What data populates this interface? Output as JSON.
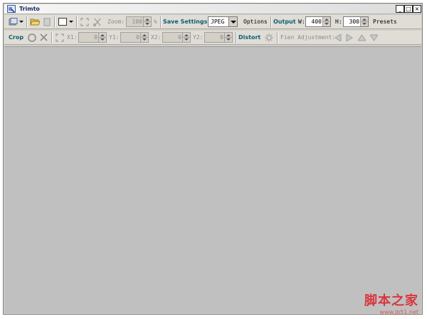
{
  "window": {
    "title": "Trimto",
    "controls": {
      "minimize": "_",
      "maximize": "□",
      "close": "×"
    }
  },
  "toolbar1": {
    "zoom_label": "Zoom:",
    "zoom_value": "100",
    "zoom_unit": "%",
    "save_settings_label": "Save Settings",
    "format_value": "JPEG",
    "options_label": "Options",
    "output_label": "Output",
    "width_label": "W:",
    "width_value": "400",
    "height_label": "H:",
    "height_value": "300",
    "presets_label": "Presets"
  },
  "toolbar2": {
    "crop_label": "Crop",
    "x1_label": "X1:",
    "x1_value": "0",
    "y1_label": "Y1:",
    "y1_value": "0",
    "x2_label": "X2:",
    "x2_value": "0",
    "y2_label": "Y2:",
    "y2_value": "0",
    "distort_label": "Distort",
    "fine_adjustment_label": "Fien Adjustment:"
  },
  "watermark": {
    "text": "脚本之家",
    "url": "www.jb51.net"
  },
  "colors": {
    "accent_teal": "#0b5f73",
    "workspace": "#c0c0c0",
    "window_bg": "#d4d0c8",
    "watermark": "#d9363e"
  },
  "icons": [
    "app-icon",
    "capture-icon",
    "dropdown-arrow-icon",
    "open-folder-icon",
    "delete-icon",
    "frame-icon",
    "fit-icon",
    "scissors-icon",
    "circle-select-icon",
    "cross-icon",
    "expand-icon",
    "settings-gear-icon",
    "arrow-left-icon",
    "arrow-right-icon",
    "arrow-up-icon",
    "arrow-down-icon"
  ]
}
